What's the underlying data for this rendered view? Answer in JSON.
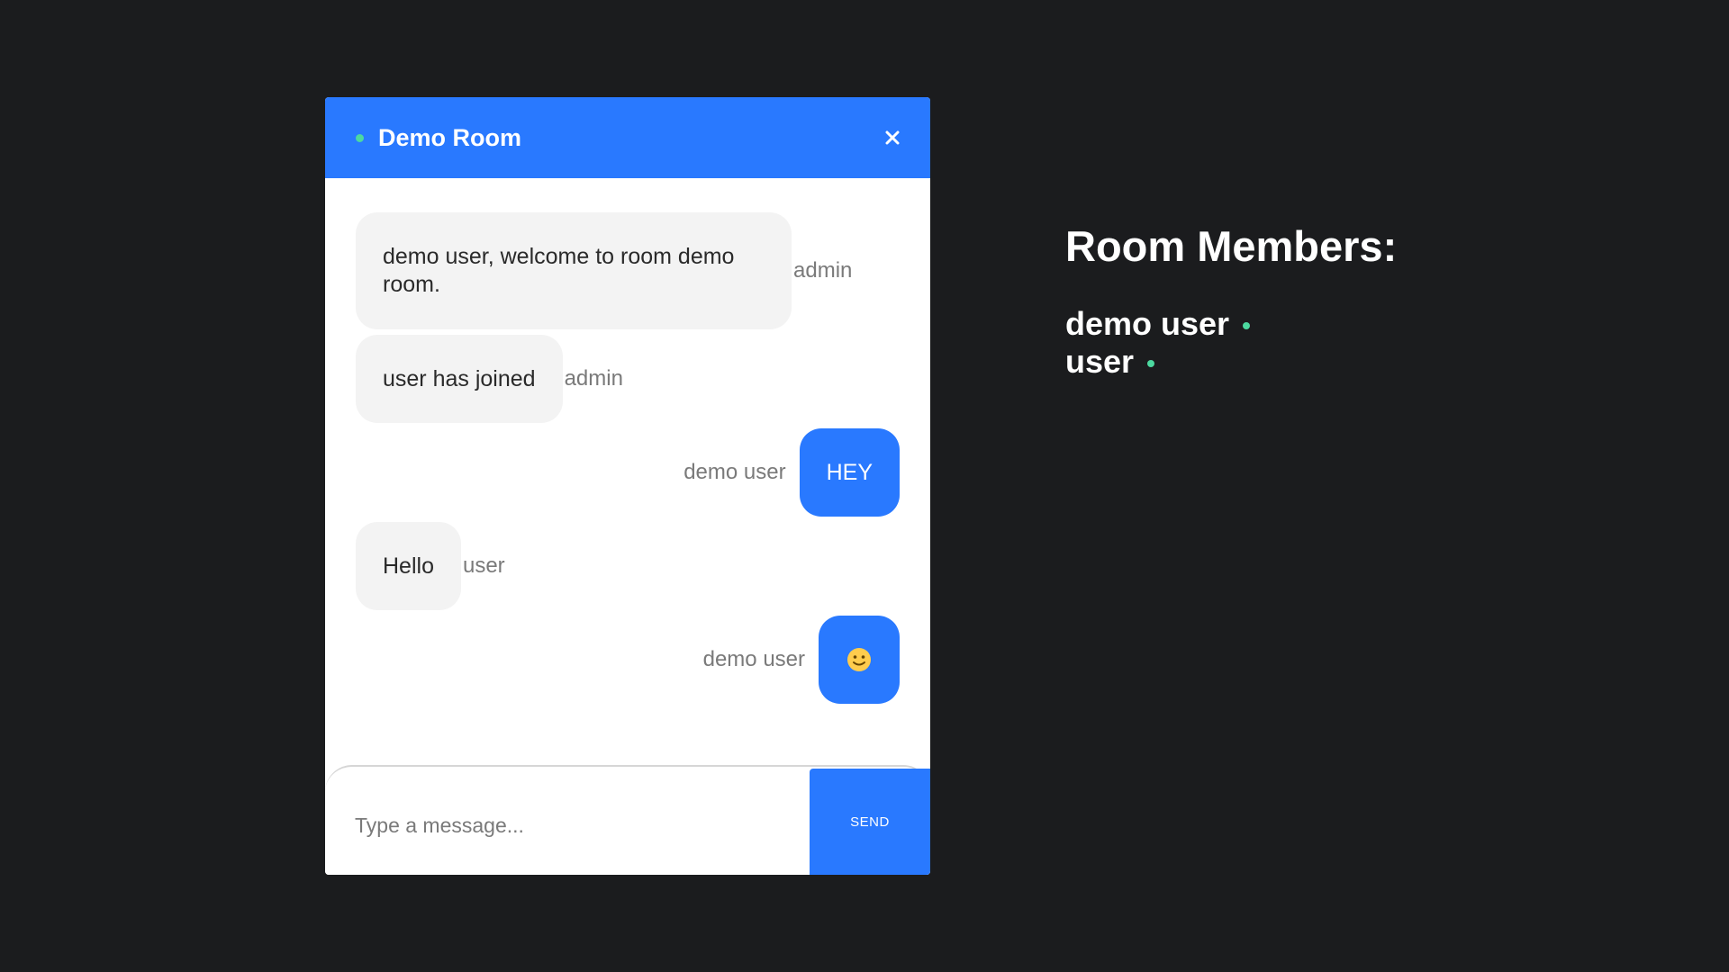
{
  "chat": {
    "room_title": "Demo Room",
    "status_color": "#4cd9a0",
    "accent_color": "#2979ff",
    "close_icon": "close-icon",
    "messages": [
      {
        "text": "demo user, welcome to room demo room.",
        "sender": "admin",
        "own": false
      },
      {
        "text": "user has joined",
        "sender": "admin",
        "own": false
      },
      {
        "text": "HEY",
        "sender": "demo user",
        "own": true
      },
      {
        "text": "Hello",
        "sender": "user",
        "own": false
      },
      {
        "text": "🙂",
        "sender": "demo user",
        "own": true,
        "icon": "smile-emoji-icon"
      }
    ],
    "composer": {
      "placeholder": "Type a message...",
      "value": "",
      "send_label": "SEND"
    }
  },
  "members": {
    "title": "Room Members:",
    "list": [
      {
        "name": "demo user",
        "online": true
      },
      {
        "name": "user",
        "online": true
      }
    ]
  }
}
